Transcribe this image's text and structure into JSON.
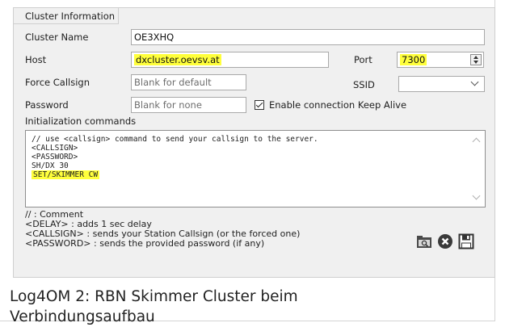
{
  "section_title": "Cluster Information",
  "fields": {
    "cluster_name": {
      "label": "Cluster Name",
      "value": "OE3XHQ"
    },
    "host": {
      "label": "Host",
      "value": "dxcluster.oevsv.at"
    },
    "port": {
      "label": "Port",
      "value": "7300"
    },
    "force_callsign": {
      "label": "Force Callsign",
      "placeholder": "Blank for default"
    },
    "ssid": {
      "label": "SSID",
      "value": ""
    },
    "password": {
      "label": "Password",
      "placeholder": "Blank for none"
    },
    "keep_alive": {
      "label": "Enable connection Keep Alive",
      "checked": true
    }
  },
  "init_commands": {
    "label": "Initialization commands",
    "lines": [
      "// use <callsign> command to send your callsign to the server.",
      "<CALLSIGN>",
      "<PASSWORD>",
      "SH/DX 30",
      "SET/SKIMMER CW"
    ]
  },
  "help_lines": [
    "// : Comment",
    "<DELAY> : adds 1 sec delay",
    "<CALLSIGN> : sends your Station Callsign (or the forced one)",
    "<PASSWORD> : sends the provided password (if any)"
  ],
  "toolbar": {
    "open_icon": "folder-search-icon",
    "cancel_icon": "cancel-circle-icon",
    "save_icon": "floppy-save-icon"
  },
  "caption_lines": [
    "Log4OM 2: RBN Skimmer Cluster beim",
    "Verbindungsaufbau"
  ],
  "colors": {
    "highlight": "#ffff3b",
    "panel": "#f0f0f0"
  }
}
